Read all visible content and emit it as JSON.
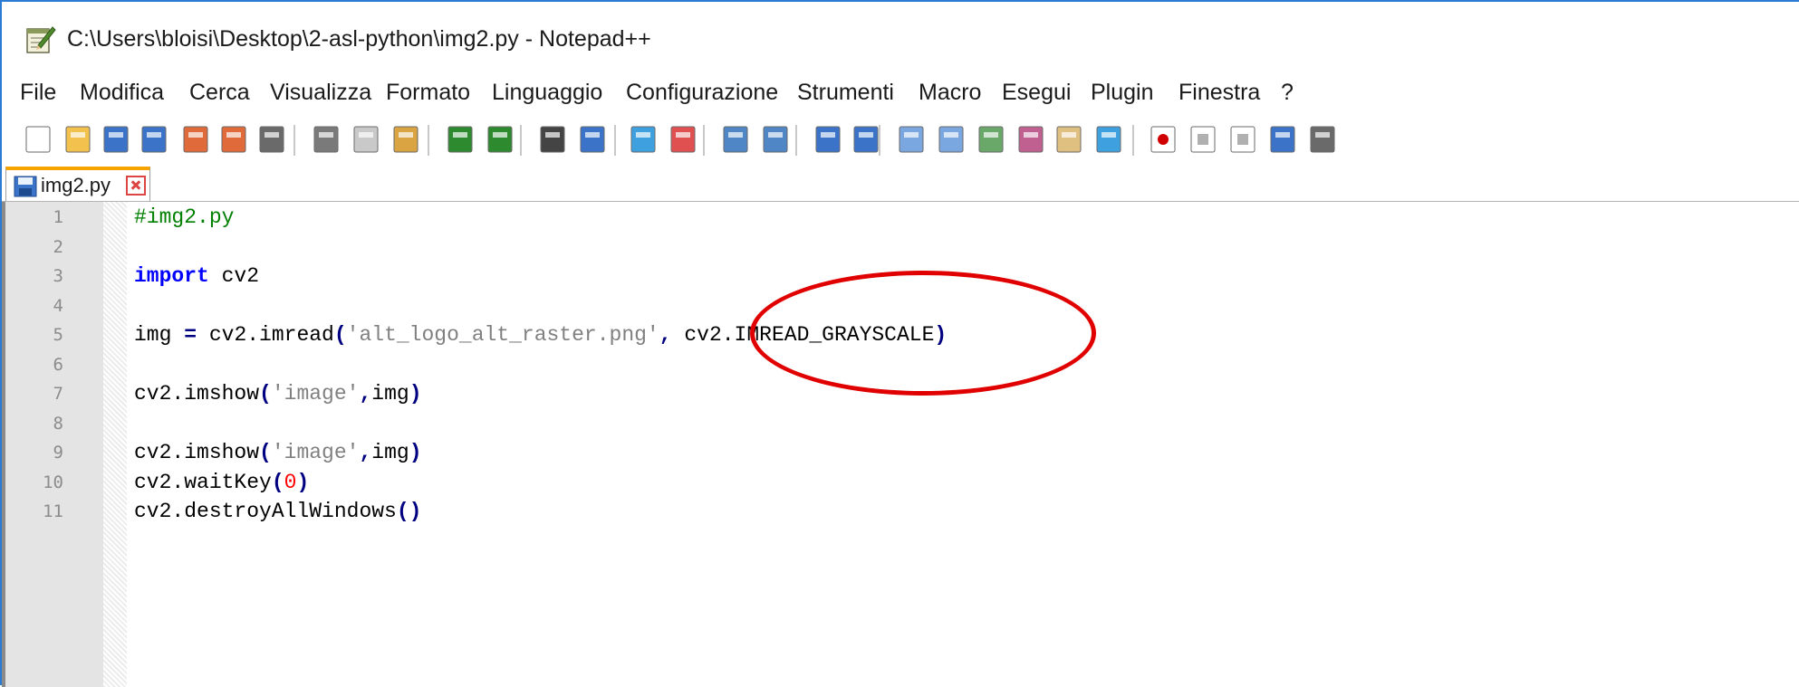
{
  "window": {
    "title": "C:\\Users\\bloisi\\Desktop\\2-asl-python\\img2.py - Notepad++",
    "app_icon": "notepad-pen-icon"
  },
  "menu": {
    "items": [
      "File",
      "Modifica",
      "Cerca",
      "Visualizza",
      "Formato",
      "Linguaggio",
      "Configurazione",
      "Strumenti",
      "Macro",
      "Esegui",
      "Plugin",
      "Finestra",
      "?"
    ]
  },
  "toolbar": {
    "icons": [
      "new-file-icon",
      "open-file-icon",
      "save-icon",
      "save-all-icon",
      "close-icon",
      "close-all-icon",
      "print-icon",
      "cut-icon",
      "copy-icon",
      "paste-icon",
      "undo-icon",
      "redo-icon",
      "find-icon",
      "replace-icon",
      "zoom-in-icon",
      "zoom-out-icon",
      "sync-vertical-icon",
      "sync-horizontal-icon",
      "word-wrap-icon",
      "show-all-chars-icon",
      "indent-guide-icon",
      "udl-icon",
      "doc-map-icon",
      "function-list-icon",
      "folder-workspace-icon",
      "monitoring-icon",
      "record-macro-icon",
      "stop-macro-icon",
      "play-macro-icon",
      "run-macro-multiple-icon",
      "save-macro-icon"
    ]
  },
  "tab": {
    "label": "img2.py",
    "icon": "save-icon"
  },
  "editor": {
    "lines": [
      {
        "n": "1",
        "tokens": [
          [
            "cmt",
            "#img2.py"
          ]
        ]
      },
      {
        "n": "2",
        "tokens": []
      },
      {
        "n": "3",
        "tokens": [
          [
            "kw",
            "import"
          ],
          [
            "plain",
            " cv2"
          ]
        ]
      },
      {
        "n": "4",
        "tokens": []
      },
      {
        "n": "5",
        "tokens": [
          [
            "plain",
            "img "
          ],
          [
            "op",
            "="
          ],
          [
            "plain",
            " cv2.imread"
          ],
          [
            "op",
            "("
          ],
          [
            "str",
            "'alt_logo_alt_raster.png'"
          ],
          [
            "op",
            ","
          ],
          [
            "plain",
            " cv2.IMREAD_GRAYSCALE"
          ],
          [
            "op",
            ")"
          ]
        ]
      },
      {
        "n": "6",
        "tokens": []
      },
      {
        "n": "7",
        "tokens": [
          [
            "plain",
            "cv2.imshow"
          ],
          [
            "op",
            "("
          ],
          [
            "str",
            "'image'"
          ],
          [
            "op",
            ","
          ],
          [
            "plain",
            "img"
          ],
          [
            "op",
            ")"
          ]
        ]
      },
      {
        "n": "8",
        "tokens": []
      },
      {
        "n": "9",
        "tokens": [
          [
            "plain",
            "cv2.imshow"
          ],
          [
            "op",
            "("
          ],
          [
            "str",
            "'image'"
          ],
          [
            "op",
            ","
          ],
          [
            "plain",
            "img"
          ],
          [
            "op",
            ")"
          ]
        ]
      },
      {
        "n": "10",
        "tokens": [
          [
            "plain",
            "cv2.waitKey"
          ],
          [
            "op",
            "("
          ],
          [
            "num",
            "0"
          ],
          [
            "op",
            ")"
          ]
        ]
      },
      {
        "n": "11",
        "tokens": [
          [
            "plain",
            "cv2.destroyAllWindows"
          ],
          [
            "op",
            "()"
          ]
        ]
      }
    ]
  },
  "annotation": {
    "color": "#e00000",
    "target": "cv2.IMREAD_GRAYSCALE)"
  }
}
